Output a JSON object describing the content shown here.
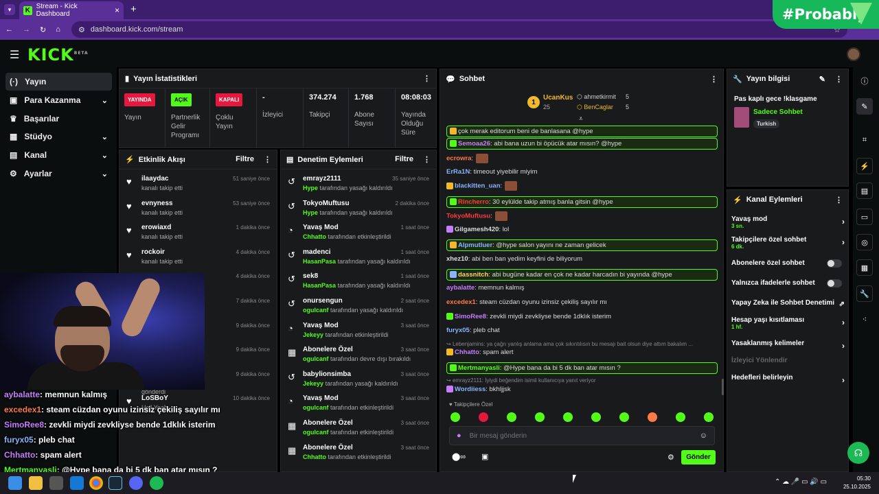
{
  "browser": {
    "tab_title": "Stream - Kick Dashboard",
    "url": "dashboard.kick.com/stream",
    "overlay_badge": "#Probably"
  },
  "logo": {
    "text": "KICK",
    "beta": "BETA"
  },
  "sidebar": {
    "items": [
      {
        "label": "Yayın",
        "icon": "broadcast-icon"
      },
      {
        "label": "Para Kazanma",
        "icon": "money-icon"
      },
      {
        "label": "Başarılar",
        "icon": "trophy-icon"
      },
      {
        "label": "Stüdyo",
        "icon": "studio-icon"
      },
      {
        "label": "Kanal",
        "icon": "channel-icon"
      },
      {
        "label": "Ayarlar",
        "icon": "gear-icon"
      }
    ]
  },
  "stats": {
    "title": "Yayın İstatistikleri",
    "cells": [
      {
        "pill": "YAYINDA",
        "pill_color": "#e5193f",
        "label": "Yayın"
      },
      {
        "pill": "AÇIK",
        "pill_color": "#53fc18",
        "label": "Partnerlik Gelir Programı"
      },
      {
        "pill": "KAPALI",
        "pill_color": "#e5193f",
        "label": "Çoklu Yayın"
      },
      {
        "value": "-",
        "label": "İzleyici"
      },
      {
        "value": "374.274",
        "label": "Takipçi"
      },
      {
        "value": "1.768",
        "label": "Abone Sayısı"
      },
      {
        "value": "08:08:03",
        "label": "Yayında Olduğu Süre"
      }
    ]
  },
  "activity": {
    "title": "Etkinlik Akışı",
    "filter": "Filtre",
    "items": [
      {
        "name": "ilaaydac",
        "sub": "kanalı takip etti",
        "time": "51 saniye önce"
      },
      {
        "name": "evnyness",
        "sub": "kanalı takip etti",
        "time": "53 saniye önce"
      },
      {
        "name": "erowiaxd",
        "sub": "kanalı takip etti",
        "time": "1 dakika önce"
      },
      {
        "name": "rockoir",
        "sub": "kanalı takip etti",
        "time": "4 dakika önce"
      },
      {
        "name": "",
        "sub": "",
        "time": "4 dakika önce"
      },
      {
        "name": "",
        "sub": "",
        "time": "7 dakika önce"
      },
      {
        "name": "",
        "sub": "",
        "time": "9 dakika önce"
      },
      {
        "name": "",
        "sub": "kanalı takip etti",
        "time": "9 dakika önce"
      },
      {
        "name": "LoSBoY",
        "sub": "Hell Yeah",
        "sub2": "gönderdi",
        "time": "9 dakika önce"
      },
      {
        "name": "LoSBoY",
        "sub": "Hell Yeah",
        "time": "10 dakika önce"
      }
    ]
  },
  "moderation": {
    "title": "Denetim Eylemleri",
    "filter": "Filtre",
    "items": [
      {
        "name": "emrayz2111",
        "by": "Hype",
        "sub": "tarafından yasağı kaldırıldı",
        "time": "35 saniye önce"
      },
      {
        "name": "TokyoMuftusu",
        "by": "Hype",
        "sub": "tarafından yasağı kaldırıldı",
        "time": "2 dakika önce"
      },
      {
        "name": "Yavaş Mod",
        "by": "Chhatto",
        "sub": "tarafından etkinleştirildi",
        "time": "1 saat önce"
      },
      {
        "name": "madenci",
        "by": "HasanPasa",
        "sub": "tarafından yasağı kaldırıldı",
        "time": "1 saat önce"
      },
      {
        "name": "sek8",
        "by": "HasanPasa",
        "sub": "tarafından yasağı kaldırıldı",
        "time": "1 saat önce"
      },
      {
        "name": "onursengun",
        "by": "ogulcanf",
        "sub": "tarafından yasağı kaldırıldı",
        "time": "2 saat önce"
      },
      {
        "name": "Yavaş Mod",
        "by": "Jekeyy",
        "sub": "tarafından etkinleştirildi",
        "time": "3 saat önce"
      },
      {
        "name": "Abonelere Özel",
        "by": "ogulcanf",
        "sub": "tarafından devre dışı bırakıldı",
        "time": "3 saat önce"
      },
      {
        "name": "babylionsimba",
        "by": "Jekeyy",
        "sub": "tarafından yasağı kaldırıldı",
        "time": "3 saat önce"
      },
      {
        "name": "Yavaş Mod",
        "by": "ogulcanf",
        "sub": "tarafından etkinleştirildi",
        "time": "3 saat önce"
      },
      {
        "name": "Abonelere Özel",
        "by": "ogulcanf",
        "sub": "tarafından etkinleştirildi",
        "time": "3 saat önce"
      },
      {
        "name": "Abonelere Özel",
        "by": "Chhatto",
        "sub": "tarafından etkinleştirildi",
        "time": "3 saat önce"
      }
    ]
  },
  "chat": {
    "title": "Sohbet",
    "leaders": [
      {
        "rank": "1",
        "name": "UcanKus",
        "value": "25"
      },
      {
        "name": "ahmetkirmit",
        "value": "5"
      },
      {
        "name": "BenCaglar",
        "value": "5"
      }
    ],
    "messages": [
      {
        "user": "",
        "text": "çok merak editorum beni de banlasana @hype",
        "color": "#ddd",
        "hl": true
      },
      {
        "user": "Semoaa26",
        "text": ": abi bana uzun bi öpücük atar mısın? @hype",
        "color": "#c77dff",
        "hl": true
      },
      {
        "user": "ecrowra",
        "text": ":",
        "color": "#ff7a45",
        "emote": true
      },
      {
        "user": "ErRa1N",
        "text": ": timeout yiyebilir miyim",
        "color": "#8ab4ff"
      },
      {
        "user": "blackitten_uan",
        "text": ":",
        "color": "#8ab4ff",
        "emote": true
      },
      {
        "user": "Rincherro",
        "text": ": 30 eylülde takip atmış banla gitsin @hype",
        "color": "#ff3b3b",
        "hl": true
      },
      {
        "user": "TokyoMuftusu",
        "text": ":",
        "color": "#ff3b3b",
        "emote": true
      },
      {
        "user": "Gilgamesh420",
        "text": ": lol",
        "color": "#dddddd"
      },
      {
        "user": "Alpmutluer",
        "text": ": @hype salon yayını ne zaman gelicek",
        "color": "#8ab4ff",
        "hl": true
      },
      {
        "user": "xhez10",
        "text": ": abi ben ban yedim keyfini de biliyorum",
        "color": "#dddddd"
      },
      {
        "user": "dassnitch",
        "text": ": abi bugüne kadar en çok ne kadar harcadın bi yayında @hype",
        "color": "#ffd166",
        "hl": true
      },
      {
        "user": "aybalatte",
        "text": ": memnun kalmış",
        "color": "#c77dff"
      },
      {
        "user": "excedex1",
        "text": ": steam cüzdan oyunu izinsiz çekiliş sayılır mı",
        "color": "#ff7a45"
      },
      {
        "user": "SimoRee8",
        "text": ": zevkli miydi zevkliyse bende 1dklık isterim",
        "color": "#c77dff"
      },
      {
        "user": "furyx05",
        "text": ": pleb chat",
        "color": "#8ab4ff"
      },
      {
        "reply": "Lebenjamins: ya çağrı yanlış anlama ama çok sıkıntılısın bu mesajı bait olsun diye attım bakalım ..."
      },
      {
        "user": "Chhatto",
        "text": ": spam alert",
        "color": "#c77dff"
      },
      {
        "user": "Mertmanyasli",
        "text": ": @Hype bana da bi 5 dk ban atar mısın ?",
        "color": "#53fc18",
        "hl": true
      },
      {
        "reply": "emrayz2111: İyiydi beğendim isimli kullanıcıya yanıt veriyor"
      },
      {
        "user": "Wordiiess",
        "text": ": bkhljjsk",
        "color": "#8ab4ff"
      }
    ],
    "followers_only_label": "Takipçilere Özel",
    "input_placeholder": "Bir mesaj gönderin",
    "send_label": "Gönder"
  },
  "info": {
    "title": "Yayın bilgisi",
    "stream_title": "Pas kaplı gece !klasgame",
    "category": "Sadece Sohbet",
    "tag": "Turkish"
  },
  "channel_actions": {
    "title": "Kanal Eylemleri",
    "items": [
      {
        "label": "Yavaş mod",
        "sub": "3 sn.",
        "kind": "arrow"
      },
      {
        "label": "Takipçilere özel sohbet",
        "sub": "6 dk.",
        "kind": "arrow"
      },
      {
        "label": "Abonelere özel sohbet",
        "kind": "toggle"
      },
      {
        "label": "Yalnızca ifadelerle sohbet",
        "kind": "toggle"
      },
      {
        "label": "Yapay Zeka ile Sohbet Denetimi",
        "kind": "external"
      },
      {
        "label": "Hesap yaşı kısıtlaması",
        "sub": "1 hf.",
        "kind": "arrow"
      },
      {
        "label": "Yasaklanmış kelimeler",
        "kind": "arrow"
      },
      {
        "label": "İzleyici Yönlendir",
        "kind": "disabled"
      },
      {
        "label": "Hedefleri belirleyin",
        "kind": "arrow"
      }
    ]
  },
  "overlay_chat": [
    {
      "user": "aybalatte",
      "text": ": memnun kalmış",
      "color": "#c77dff"
    },
    {
      "user": "excedex1",
      "text": ": steam cüzdan oyunu izinsiz çekiliş sayılır mı",
      "color": "#ff7a45"
    },
    {
      "user": "SimoRee8",
      "text": ": zevkli miydi zevkliyse bende 1dklık isterim",
      "color": "#c77dff"
    },
    {
      "user": "furyx05",
      "text": ": pleb chat",
      "color": "#8ab4ff"
    },
    {
      "user": "Chhatto",
      "text": ": spam alert",
      "color": "#c77dff"
    },
    {
      "user": "Mertmanyasli",
      "text": ": @Hype bana da bi 5 dk ban atar mısın ?",
      "color": "#53fc18"
    }
  ],
  "taskbar": {
    "time": "05:30",
    "date": "25.10.2025"
  },
  "colors": {
    "accent": "#53fc18",
    "browser": "#5b2f98"
  }
}
